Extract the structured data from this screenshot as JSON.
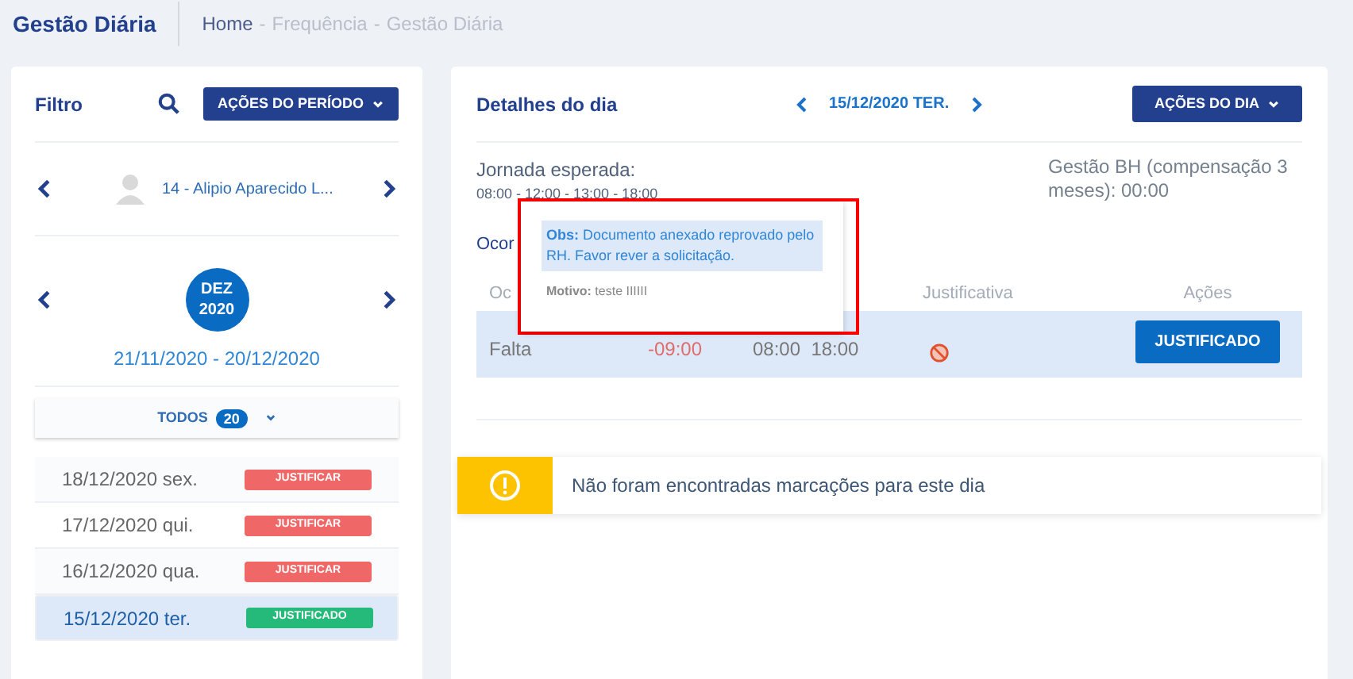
{
  "header": {
    "title": "Gestão Diária",
    "breadcrumb": [
      {
        "label": "Home",
        "current": false
      },
      {
        "label": "Frequência",
        "current": true
      },
      {
        "label": "Gestão Diária",
        "current": true
      }
    ],
    "separator": "-"
  },
  "filter": {
    "title": "Filtro",
    "period_actions": "AÇÕES DO PERÍODO",
    "employee": "14 - Alipio Aparecido L...",
    "month": "DEZ",
    "year": "2020",
    "range": "21/11/2020 - 20/12/2020",
    "todos": {
      "label": "TODOS",
      "count": "20"
    },
    "days": [
      {
        "date": "18/12/2020 sex.",
        "status": "JUSTIFICAR",
        "kind": "pending",
        "selected": false
      },
      {
        "date": "17/12/2020 qui.",
        "status": "JUSTIFICAR",
        "kind": "pending",
        "selected": false
      },
      {
        "date": "16/12/2020 qua.",
        "status": "JUSTIFICAR",
        "kind": "pending",
        "selected": false
      },
      {
        "date": "15/12/2020 ter.",
        "status": "JUSTIFICADO",
        "kind": "done",
        "selected": true
      }
    ]
  },
  "details": {
    "title": "Detalhes do dia",
    "date": "15/12/2020 TER.",
    "day_actions": "AÇÕES DO DIA",
    "expected_label": "Jornada esperada:",
    "expected_hours": "08:00 - 12:00 - 13:00 - 18:00",
    "bank": "Gestão BH (compensação 3 meses): 00:00",
    "occurrences_title": "Ocor",
    "columns": [
      "Oc",
      "Justificativa",
      "Ações"
    ],
    "rows": [
      {
        "type": "Falta",
        "balance": "-09:00",
        "start": "08:00",
        "end": "18:00",
        "action": "JUSTIFICADO"
      }
    ],
    "tooltip": {
      "obs_label": "Obs:",
      "obs": "Documento anexado reprovado pelo RH. Favor rever a solicitação.",
      "reason_label": "Motivo:",
      "reason": "teste IIIIII"
    },
    "alert": "Não foram encontradas marcações para este dia"
  }
}
